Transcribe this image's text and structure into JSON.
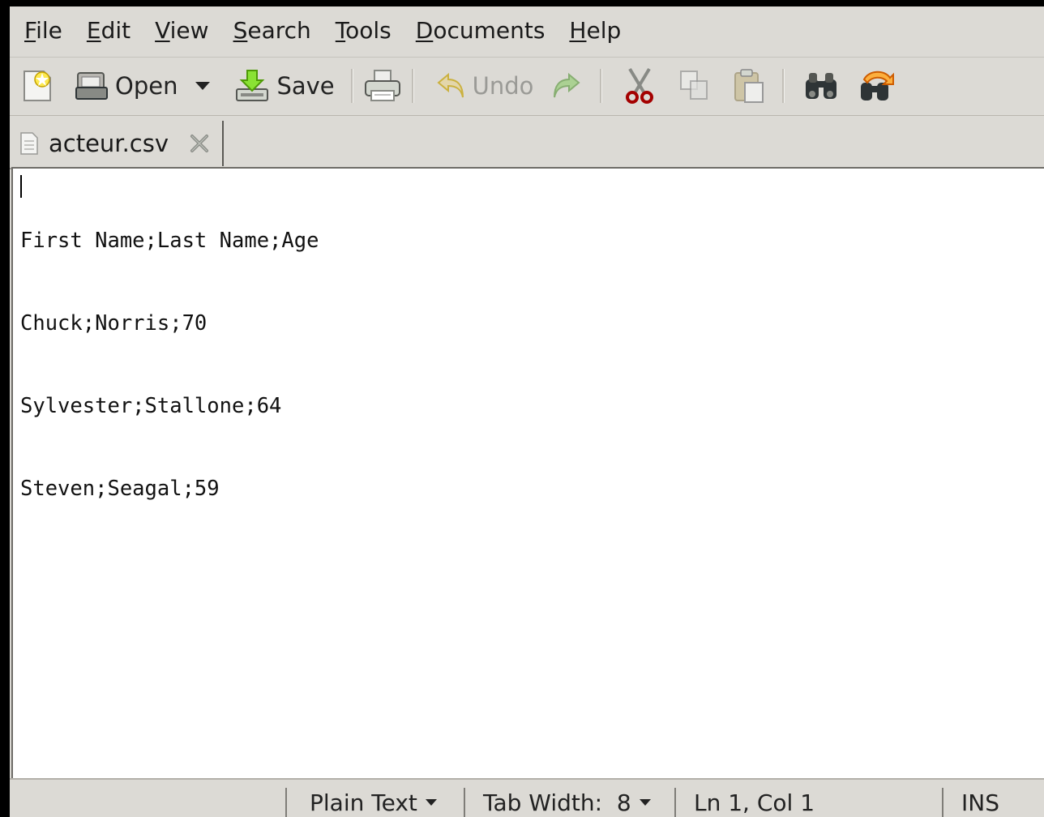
{
  "menubar": {
    "items": [
      {
        "underline": "F",
        "rest": "ile"
      },
      {
        "underline": "E",
        "rest": "dit"
      },
      {
        "underline": "V",
        "rest": "iew"
      },
      {
        "underline": "S",
        "rest": "earch"
      },
      {
        "underline": "T",
        "rest": "ools"
      },
      {
        "underline": "D",
        "rest": "ocuments"
      },
      {
        "underline": "H",
        "rest": "elp"
      }
    ]
  },
  "toolbar": {
    "open_label": "Open",
    "save_label": "Save",
    "undo_label": "Undo"
  },
  "tabs": [
    {
      "label": "acteur.csv"
    }
  ],
  "editor": {
    "lines": [
      "First Name;Last Name;Age",
      "Chuck;Norris;70",
      "Sylvester;Stallone;64",
      "Steven;Seagal;59"
    ]
  },
  "statusbar": {
    "language": "Plain Text",
    "tab_width": "Tab Width:  8",
    "position": "Ln 1, Col 1",
    "mode": "INS"
  },
  "colors": {
    "chrome": "#dcdad5",
    "editor_bg": "#ffffff",
    "icon_green": "#4e9a06",
    "icon_red": "#a40000",
    "icon_orange": "#f57900"
  }
}
